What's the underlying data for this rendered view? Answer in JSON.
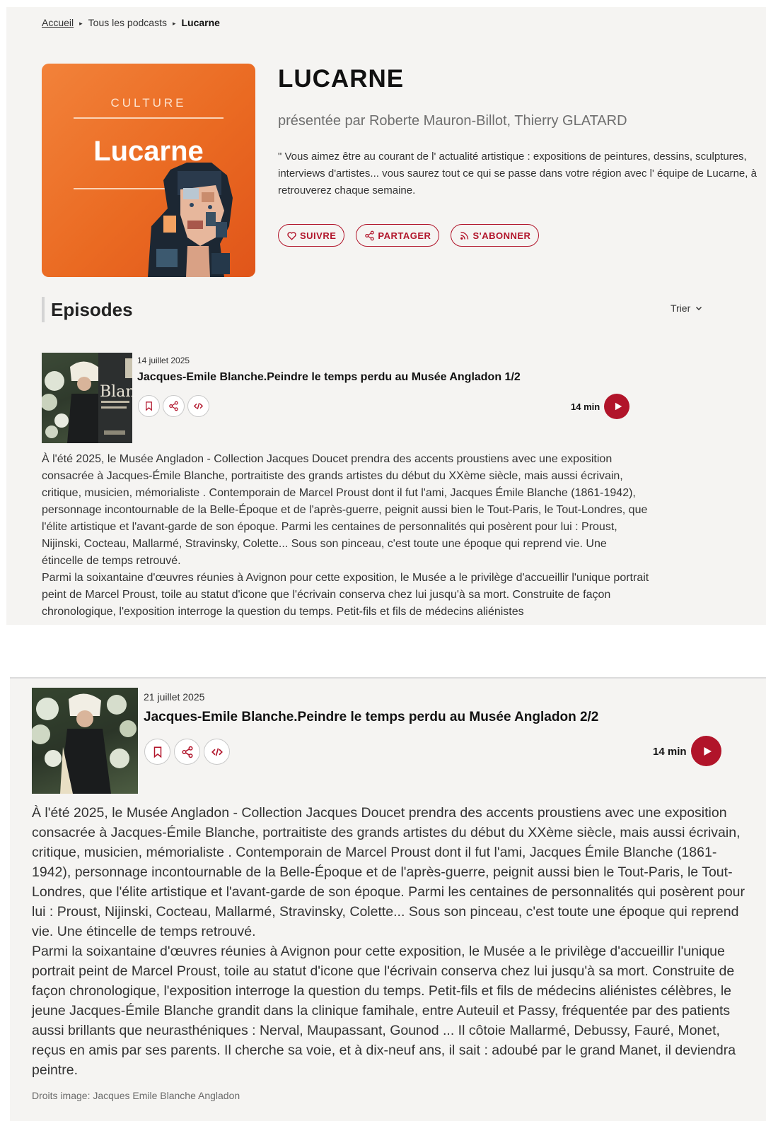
{
  "breadcrumb": {
    "home": "Accueil",
    "all_podcasts": "Tous les podcasts",
    "current": "Lucarne"
  },
  "podcast": {
    "cover_category": "CULTURE",
    "cover_name": "Lucarne",
    "title": "LUCARNE",
    "hosts": "présentée par Roberte Mauron-Billot, Thierry GLATARD",
    "description": "\" Vous aimez être au courant de l' actualité artistique : expositions de peintures, dessins, sculptures, interviews d'artistes... vous saurez tout ce qui se passe dans votre région avec l' équipe de Lucarne, à retrouverez chaque semaine.",
    "buttons": {
      "follow": "SUIVRE",
      "share": "PARTAGER",
      "subscribe": "S'ABONNER"
    }
  },
  "episodes_section": {
    "heading": "Episodes",
    "sort_label": "Trier"
  },
  "episodes": [
    {
      "date": "14 juillet 2025",
      "title": "Jacques-Emile Blanche.Peindre le temps perdu au Musée Angladon 1/2",
      "duration": "14 min",
      "thumb_text": "Jacques-Emile Blanche",
      "summary": [
        "À l'été 2025, le Musée Angladon - Collection Jacques Doucet prendra des accents proustiens avec une exposition consacrée à Jacques-Émile Blanche, portraitiste des grands artistes du début du XXème siècle, mais aussi écrivain, critique, musicien, mémorialiste . Contemporain de Marcel Proust dont il fut l'ami, Jacques Émile Blanche (1861-1942), personnage incontournable de la Belle-Époque et de l'après-guerre, peignit aussi bien le Tout-Paris, le Tout-Londres, que l'élite artistique et l'avant-garde de son époque. Parmi les centaines de personnalités qui posèrent pour lui : Proust, Nijinski, Cocteau, Mallarmé, Stravinsky, Colette... Sous son pinceau, c'est toute une époque qui reprend vie. Une étincelle de temps retrouvé.",
        "Parmi la soixantaine d'œuvres réunies à Avignon pour cette exposition, le Musée a le privilège d'accueillir l'unique portrait peint de Marcel Proust, toile au statut d'icone que l'écrivain conserva chez lui jusqu'à sa mort. Construite de façon chronologique, l'exposition interroge la question du temps. Petit-fils et fils de médecins aliénistes"
      ]
    },
    {
      "date": "21 juillet 2025",
      "title": "Jacques-Emile Blanche.Peindre le temps perdu au Musée Angladon 2/2",
      "duration": "14 min",
      "summary": [
        "À l'été 2025, le Musée Angladon - Collection Jacques Doucet prendra des accents proustiens avec une exposition consacrée à Jacques-Émile Blanche, portraitiste des grands artistes du début du XXème siècle, mais aussi écrivain, critique, musicien, mémorialiste . Contemporain de Marcel Proust dont il fut l'ami, Jacques Émile Blanche (1861-1942), personnage incontournable de la Belle-Époque et de l'après-guerre, peignit aussi bien le Tout-Paris, le Tout-Londres, que l'élite artistique et l'avant-garde de son époque. Parmi les centaines de personnalités qui posèrent pour lui : Proust, Nijinski, Cocteau, Mallarmé, Stravinsky, Colette... Sous son pinceau, c'est toute une époque qui reprend vie. Une étincelle de temps retrouvé.",
        "Parmi la soixantaine d'œuvres réunies à Avignon pour cette exposition, le Musée a le privilège d'accueillir l'unique portrait peint de Marcel Proust, toile au statut d'icone que l'écrivain conserva chez lui jusqu'à sa mort. Construite de façon chronologique, l'exposition interroge la question du temps. Petit-fils et fils de médecins aliénistes célèbres, le jeune Jacques-Émile Blanche grandit dans la clinique famihale, entre Auteuil et Passy, fréquentée par des patients aussi brillants que neurasthéniques : Nerval, Maupassant, Gounod ... Il côtoie Mallarmé, Debussy, Fauré, Monet, reçus en amis par ses parents. Il cherche sa voie, et à dix-neuf ans, il sait : adoubé par le grand Manet, il deviendra peintre."
      ],
      "credit": "Droits image: Jacques Emile Blanche Angladon"
    }
  ],
  "icons": {
    "follow": "heart-icon",
    "share": "share-icon",
    "subscribe": "rss-icon",
    "bookmark": "bookmark-icon",
    "embed": "code-icon",
    "play": "play-icon",
    "sort": "chevron-down-icon"
  },
  "colors": {
    "accent": "#b1142a",
    "cover_orange": "#ea6a22",
    "panel_bg": "#f5f4f2"
  }
}
